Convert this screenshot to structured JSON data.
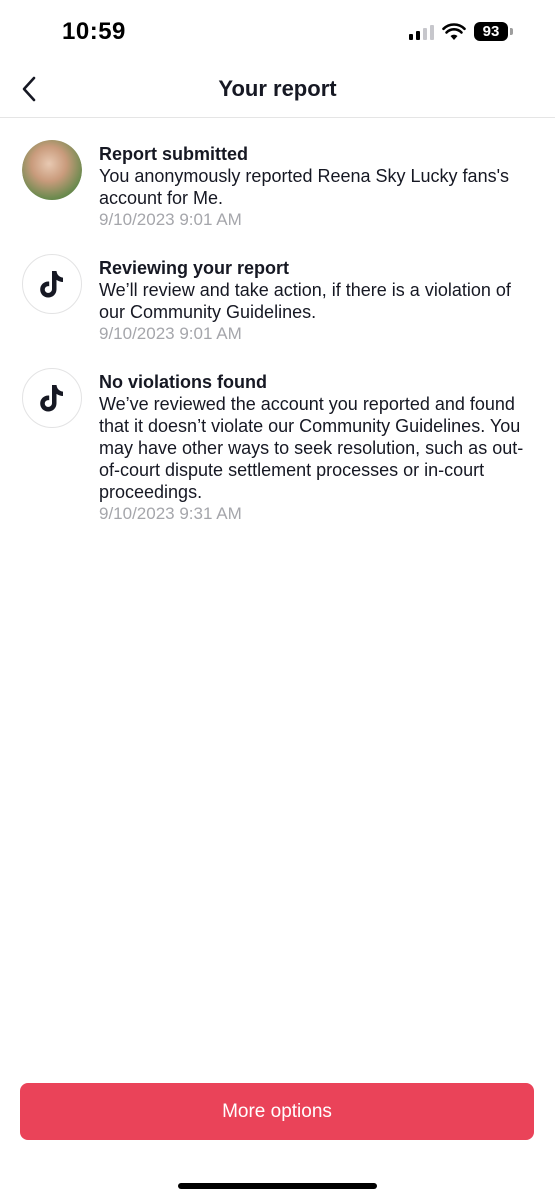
{
  "status_bar": {
    "time": "10:59",
    "battery": "93",
    "icons": [
      "cellular-signal-icon",
      "wifi-icon",
      "battery-icon"
    ]
  },
  "header": {
    "title": "Your report",
    "back_icon": "chevron-left-icon"
  },
  "timeline": [
    {
      "icon": "user-avatar",
      "title": "Report submitted",
      "description": "You anonymously reported Reena Sky Lucky fans's account for Me.",
      "timestamp": "9/10/2023 9:01 AM"
    },
    {
      "icon": "tiktok-logo-icon",
      "title": "Reviewing your report",
      "description": "We’ll review and take action, if there is a violation of our Community Guidelines.",
      "timestamp": "9/10/2023 9:01 AM"
    },
    {
      "icon": "tiktok-logo-icon",
      "title": "No violations found",
      "description": "We’ve reviewed the account you reported and found that it doesn’t violate our Community Guidelines. You may have other ways to seek resolution, such as out-of-court dispute settlement processes or in-court proceedings.",
      "timestamp": "9/10/2023 9:31 AM"
    }
  ],
  "footer": {
    "button_label": "More options"
  },
  "colors": {
    "accent": "#ea4359",
    "text_primary": "#161823",
    "text_secondary": "#a5a6ab",
    "divider": "#e5e5e5"
  }
}
